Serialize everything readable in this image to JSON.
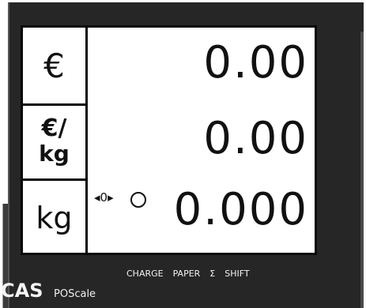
{
  "labels": {
    "price": "€",
    "unit_price_top": "€/",
    "unit_price_bottom": "kg",
    "weight": "kg"
  },
  "values": {
    "price": "0.00",
    "unit_price": "0.00",
    "weight": "0.000"
  },
  "indicators": {
    "zero": "◂0▸",
    "items": [
      "CHARGE",
      "PAPER",
      "Σ",
      "SHIFT"
    ]
  },
  "brand": {
    "name": "CAS",
    "model": "POScale"
  }
}
